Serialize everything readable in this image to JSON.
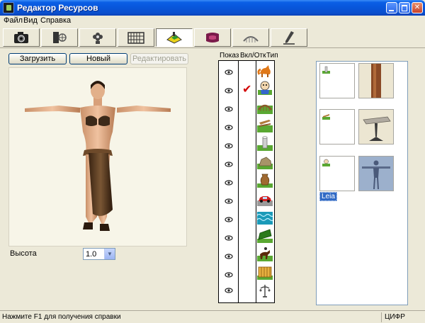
{
  "window": {
    "title": "Редактор Ресурсов"
  },
  "menu": {
    "items": [
      "Файл",
      "Вид",
      "Справка"
    ]
  },
  "toolbar": {
    "tabs": [
      {
        "icon": "camera-icon"
      },
      {
        "icon": "fan-icon"
      },
      {
        "icon": "flower-icon"
      },
      {
        "icon": "fence-icon"
      },
      {
        "icon": "character-icon",
        "active": true
      },
      {
        "icon": "carpet-icon"
      },
      {
        "icon": "bridge-icon"
      },
      {
        "icon": "pencil-icon"
      }
    ]
  },
  "actions": {
    "load_label": "Загрузить",
    "new_label": "Новый",
    "edit_label": "Редактировать"
  },
  "properties": {
    "height_label": "Высота",
    "height_value": "1.0"
  },
  "columns": {
    "show_label": "Показ",
    "toggle_label": "Вкл/Отк",
    "type_label": "Тип"
  },
  "types": [
    "fox-icon",
    "person-icon",
    "bridge-icon",
    "bench-icon",
    "post-icon",
    "rock-icon",
    "vase-icon",
    "car-icon",
    "water-icon",
    "hedge-icon",
    "rider-icon",
    "fence-icon",
    "lamp-icon"
  ],
  "assets": {
    "selected_name": "Leia"
  },
  "status": {
    "help_text": "Нажмите F1 для получения справки",
    "mode": "ЦИФР"
  }
}
